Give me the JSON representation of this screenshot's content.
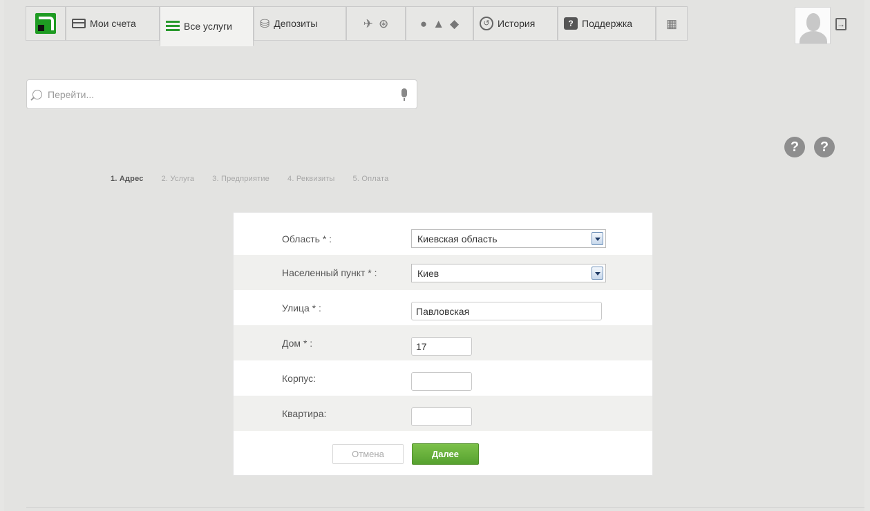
{
  "nav": {
    "accounts_label": "Мои счета",
    "all_services_label": "Все услуги",
    "deposits_label": "Депозиты",
    "history_label": "История",
    "support_label": "Поддержка"
  },
  "search": {
    "placeholder": "Перейти..."
  },
  "steps": [
    "1. Адрес",
    "2. Услуга",
    "3. Предприятие",
    "4. Реквизиты",
    "5. Оплата"
  ],
  "form": {
    "region_label": "Область * :",
    "region_value": "Киевская область",
    "city_label": "Населенный пункт * :",
    "city_value": "Киев",
    "street_label": "Улица * :",
    "street_value": "Павловская",
    "house_label": "Дом * :",
    "house_value": "17",
    "building_label": "Корпус:",
    "building_value": "",
    "apartment_label": "Квартира:",
    "apartment_value": "",
    "cancel_label": "Отмена",
    "next_label": "Далее"
  },
  "colors": {
    "brand_green": "#1e9b22",
    "button_green": "#5aa633"
  },
  "icons": [
    "logo-icon",
    "card-icon",
    "list-icon",
    "piggybank-icon",
    "transport-icon",
    "globe-icon",
    "apple-icon",
    "android-icon",
    "windows-icon",
    "history-icon",
    "support-icon",
    "cart-icon",
    "user-avatar",
    "exit-icon",
    "help-video-icon",
    "help-icon",
    "search-icon",
    "microphone-icon",
    "dropdown-arrow-icon"
  ]
}
